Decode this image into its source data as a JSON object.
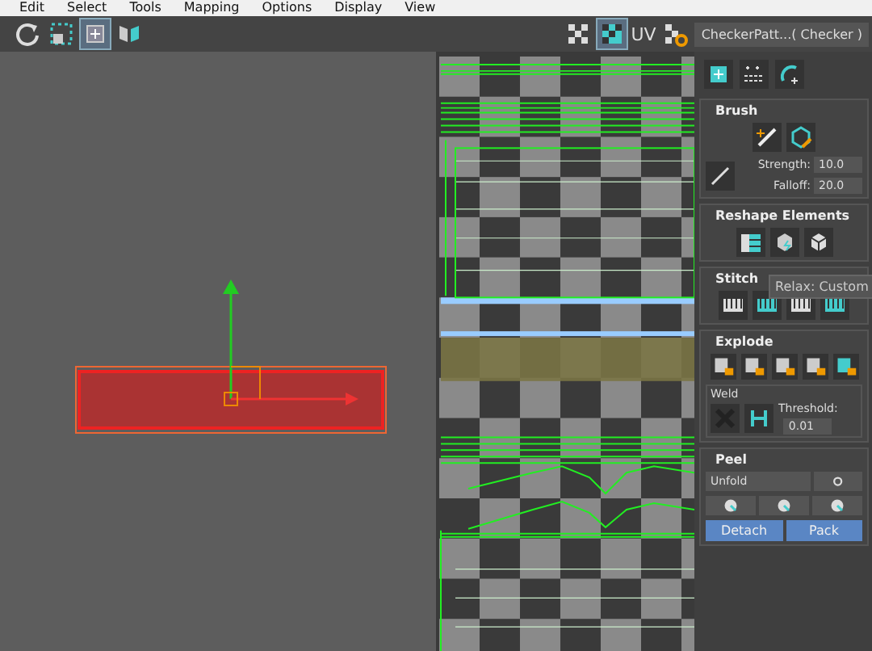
{
  "menu_bar": [
    "Edit",
    "Select",
    "Tools",
    "Mapping",
    "Options",
    "Display",
    "View"
  ],
  "toolbar": {
    "uv_label": "UV",
    "texture_dropdown": "CheckerPatt...( Checker )"
  },
  "brush": {
    "title": "Brush",
    "strength": {
      "label": "Strength:",
      "value": "10.0"
    },
    "falloff": {
      "label": "Falloff:",
      "value": "20.0"
    }
  },
  "reshape_elements": {
    "title": "Reshape Elements"
  },
  "tooltip": "Relax: Custom",
  "stitch": {
    "title": "Stitch"
  },
  "explode": {
    "title": "Explode",
    "weld": {
      "title": "Weld",
      "threshold_label": "Threshold:",
      "threshold_value": "0.01"
    }
  },
  "peel": {
    "title": "Peel",
    "dropdown": "Unfold",
    "buttons": [
      "Detach",
      "Pack"
    ]
  }
}
